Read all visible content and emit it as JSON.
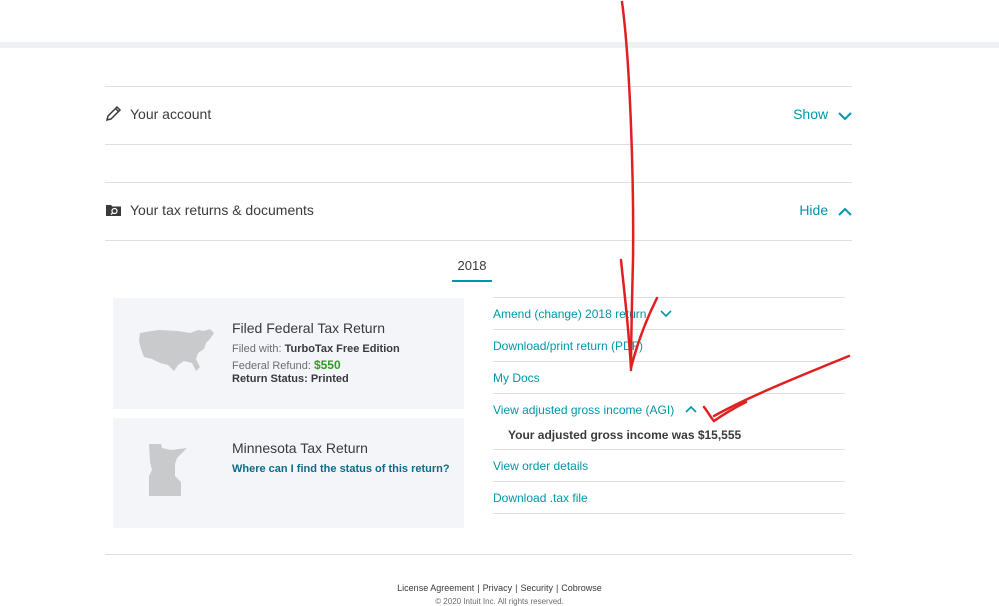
{
  "account_section": {
    "label": "Your account",
    "toggle": "Show"
  },
  "returns_section": {
    "label": "Your tax returns & documents",
    "toggle": "Hide"
  },
  "year_tab": "2018",
  "federal_card": {
    "title": "Filed Federal Tax Return",
    "filed_with_label": "Filed with:",
    "filed_with_value": "TurboTax Free Edition",
    "refund_label": "Federal Refund:",
    "refund_value": "$550",
    "status_label": "Return Status:",
    "status_value": "Printed"
  },
  "state_card": {
    "title": "Minnesota Tax Return",
    "link": "Where can I find the status of this return?"
  },
  "links": {
    "amend": "Amend (change) 2018 return",
    "download_print": "Download/print return (PDF)",
    "my_docs": "My Docs",
    "agi": "View adjusted gross income (AGI)",
    "agi_value": "Your adjusted gross income was $15,555",
    "order_details": "View order details",
    "download_tax": "Download .tax file"
  },
  "footer": {
    "license": "License Agreement",
    "privacy": "Privacy",
    "security": "Security",
    "cobrowse": "Cobrowse",
    "copyright": "© 2020 Intuit Inc. All rights reserved."
  },
  "colors": {
    "accent": "#0097a8",
    "refund": "#2ca01c",
    "annotation": "#e02020"
  }
}
